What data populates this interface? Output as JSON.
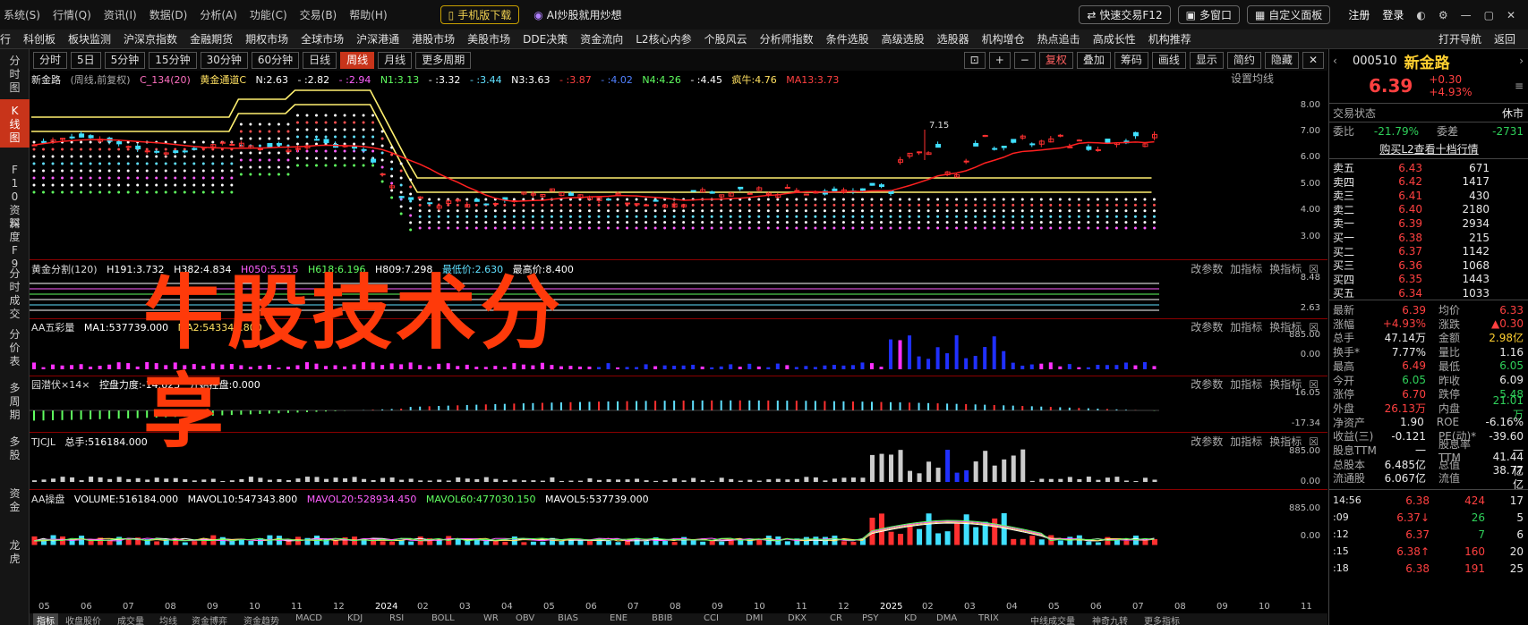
{
  "menu": [
    "系统(S)",
    "行情(Q)",
    "资讯(I)",
    "数据(D)",
    "分析(A)",
    "功能(C)",
    "交易(B)",
    "帮助(H)"
  ],
  "promo": {
    "download": "手机版下载",
    "ai": "AI炒股就用炒想"
  },
  "top_right": {
    "quick_trade": "快速交易F12",
    "multi_window": "多窗口",
    "custom_panel": "自定义面板",
    "register": "注册",
    "login": "登录"
  },
  "nav": [
    "行",
    "科创板",
    "板块监测",
    "沪深京指数",
    "金融期货",
    "期权市场",
    "全球市场",
    "沪深港通",
    "港股市场",
    "美股市场",
    "DDE决策",
    "资金流向",
    "L2核心内参",
    "个股风云",
    "分析师指数",
    "条件选股",
    "高级选股",
    "选股器",
    "机构增仓",
    "热点追击",
    "高成长性",
    "机构推荐"
  ],
  "nav_right": {
    "open_guide": "打开导航",
    "back": "返回"
  },
  "left_nav": [
    "分时图",
    "K线图",
    "F10资料",
    "深度F9",
    "分时成交",
    "分价表",
    "多周期",
    "多股",
    "资金",
    "龙虎"
  ],
  "periods": [
    "分时",
    "5日",
    "5分钟",
    "15分钟",
    "30分钟",
    "60分钟",
    "日线",
    "周线",
    "月线",
    "更多周期"
  ],
  "active_period": "周线",
  "tools_right": [
    "复权",
    "叠加",
    "筹码",
    "画线",
    "显示",
    "简约",
    "隐藏"
  ],
  "kline": {
    "name": "新金路",
    "sub": "(周线,前复权)",
    "indicator": "C_134(20)",
    "items": [
      "黄金通道C",
      "N:2.63",
      "- :2.82",
      "- :2.94",
      "N1:3.13",
      "- :3.32",
      "- :3.44",
      "N3:3.63",
      "- :3.87",
      "- :4.02",
      "N4:4.26",
      "- :4.45",
      "疯牛:4.76",
      "MA13:3.73"
    ],
    "setting": "设置均线",
    "high_mark": "7.15",
    "yticks": [
      "8.00",
      "7.00",
      "6.00",
      "5.00",
      "4.00",
      "3.00"
    ]
  },
  "p1": {
    "title": "黄金分割(120)",
    "items": [
      "H191:3.732",
      "H382:4.834",
      "H050:5.515",
      "H618:6.196",
      "H809:7.298",
      "最低价:2.630",
      "最高价:8.400"
    ],
    "yticks": [
      "8.48",
      "2.63"
    ]
  },
  "p2": {
    "title": "AA五彩量",
    "items": [
      "MA1:537739.000",
      "MA2:543343.800"
    ],
    "yticks": [
      "885.00",
      "0.00"
    ]
  },
  "p3": {
    "title": "园潜伏×14×",
    "items": [
      "控盘力度:-14.623",
      "开始控盘:0.000"
    ],
    "yticks": [
      "16.05",
      "-17.34"
    ]
  },
  "p4": {
    "title": "TJCJL",
    "items": [
      "总手:516184.000"
    ],
    "yticks": [
      "885.00",
      "0.00"
    ]
  },
  "p5": {
    "title": "AA操盘",
    "items": [
      "VOLUME:516184.000",
      "MAVOL10:547343.800",
      "MAVOL20:528934.450",
      "MAVOL60:477030.150",
      "MAVOL5:537739.000"
    ],
    "yticks": [
      "885.00",
      "0.00"
    ]
  },
  "panel_btns": [
    "改参数",
    "加指标",
    "换指标"
  ],
  "xaxis": [
    "05",
    "06",
    "07",
    "08",
    "09",
    "10",
    "11",
    "12",
    "2024",
    "02",
    "03",
    "04",
    "05",
    "06",
    "07",
    "08",
    "09",
    "10",
    "11",
    "12",
    "2025",
    "02",
    "03",
    "04",
    "05",
    "06",
    "07",
    "08",
    "09",
    "10",
    "11"
  ],
  "bottom_tabs": [
    "指标",
    "收盘股价",
    "成交量",
    "均线",
    "资金博弈",
    "资金趋势",
    "MACD",
    "KDJ",
    "RSI",
    "BOLL",
    "WR",
    "OBV",
    "BIAS",
    "ENE",
    "BBIB",
    "CCI",
    "DMI",
    "DKX",
    "CR",
    "PSY",
    "KD",
    "DMA",
    "TRIX",
    "中线成交量",
    "神奇九转",
    "更多指标"
  ],
  "watermark": "牛股技术分享",
  "stock": {
    "code": "000510",
    "name": "新金路",
    "price": "6.39",
    "change": "+0.30",
    "pct": "+4.93%"
  },
  "trade_status": {
    "label": "交易状态",
    "value": "休市"
  },
  "order": {
    "ratio_label": "委比",
    "ratio": "-21.79%",
    "diff_label": "委差",
    "diff": "-2731",
    "l2": "购买L2查看十档行情"
  },
  "asks": [
    [
      "卖五",
      "6.43",
      "671"
    ],
    [
      "卖四",
      "6.42",
      "1417"
    ],
    [
      "卖三",
      "6.41",
      "430"
    ],
    [
      "卖二",
      "6.40",
      "2180"
    ],
    [
      "卖一",
      "6.39",
      "2934"
    ]
  ],
  "bids": [
    [
      "买一",
      "6.38",
      "215"
    ],
    [
      "买二",
      "6.37",
      "1142"
    ],
    [
      "买三",
      "6.36",
      "1068"
    ],
    [
      "买四",
      "6.35",
      "1443"
    ],
    [
      "买五",
      "6.34",
      "1033"
    ]
  ],
  "stats": [
    [
      "最新",
      "6.39",
      "均价",
      "6.33"
    ],
    [
      "涨幅",
      "+4.93%",
      "涨跌",
      "▲0.30"
    ],
    [
      "总手",
      "47.14万",
      "金额",
      "2.98亿"
    ],
    [
      "换手*",
      "7.77%",
      "量比",
      "1.16"
    ],
    [
      "最高",
      "6.49",
      "最低",
      "6.05"
    ],
    [
      "今开",
      "6.05",
      "昨收",
      "6.09"
    ],
    [
      "涨停",
      "6.70",
      "跌停",
      "5.48"
    ],
    [
      "外盘",
      "26.13万",
      "内盘",
      "21.01万"
    ],
    [
      "净资产",
      "1.90",
      "ROE",
      "-6.16%"
    ],
    [
      "收益(三)",
      "-0.121",
      "PE(动)*",
      "-39.60"
    ],
    [
      "股息TTM",
      "一",
      "股息率TTM",
      "一"
    ],
    [
      "总股本",
      "6.485亿",
      "总值",
      "41.44亿"
    ],
    [
      "流通股",
      "6.067亿",
      "流值",
      "38.77亿"
    ]
  ],
  "ticks": [
    [
      "14:56",
      "6.38",
      "424",
      "17"
    ],
    [
      ":09",
      "6.37↓",
      "26",
      "5"
    ],
    [
      ":12",
      "6.37",
      "7",
      "6"
    ],
    [
      ":15",
      "6.38↑",
      "160",
      "20"
    ],
    [
      ":18",
      "6.38",
      "191",
      "25"
    ]
  ]
}
